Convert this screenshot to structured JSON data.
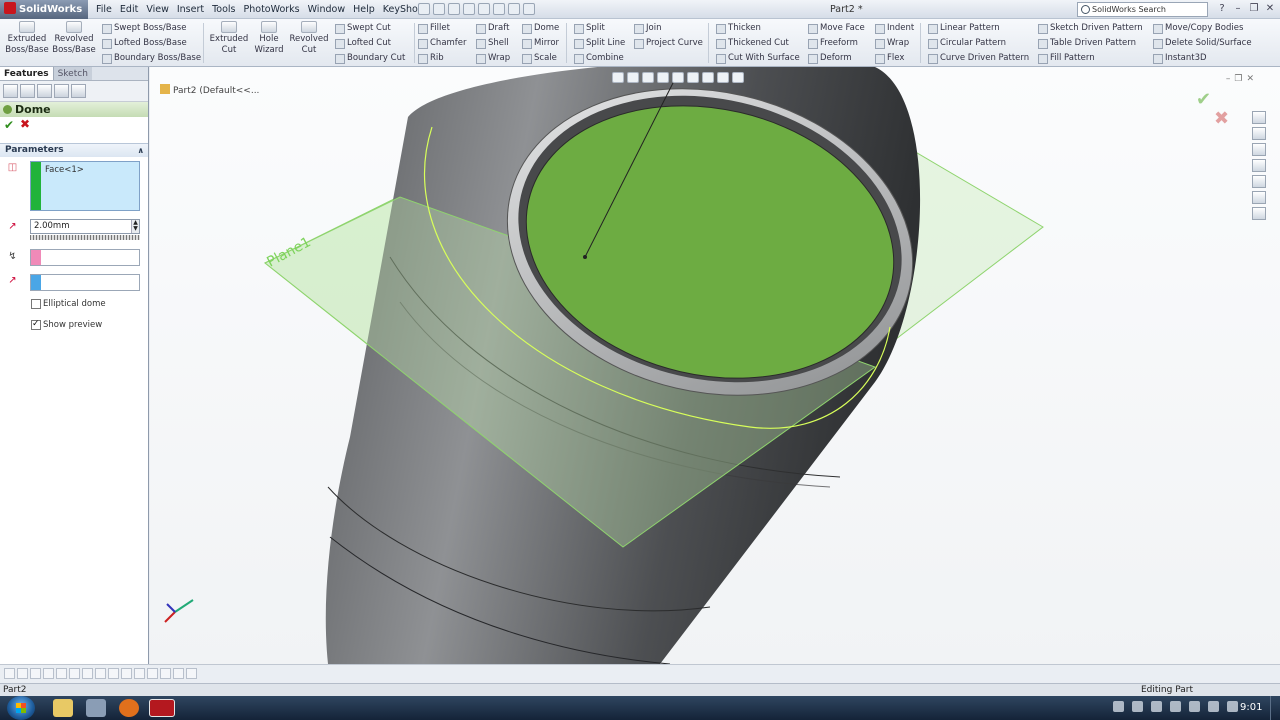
{
  "app": {
    "logo": "SolidWorks",
    "document_title": "Part2 *",
    "search_placeholder": "SolidWorks Search"
  },
  "menu": [
    "File",
    "Edit",
    "View",
    "Insert",
    "Tools",
    "PhotoWorks",
    "Window",
    "Help",
    "KeyShot"
  ],
  "cmd_big": [
    {
      "label": "Extruded Boss/Base",
      "icon": "extrude-boss-icon"
    },
    {
      "label": "Revolved Boss/Base",
      "icon": "revolve-boss-icon"
    },
    {
      "label": "Extruded Cut",
      "icon": "extrude-cut-icon"
    },
    {
      "label": "Hole Wizard",
      "icon": "hole-wizard-icon"
    },
    {
      "label": "Revolved Cut",
      "icon": "revolve-cut-icon"
    }
  ],
  "cmd_small": [
    [
      "Swept Boss/Base",
      "Lofted Boss/Base",
      "Boundary Boss/Base"
    ],
    [
      "Swept Cut",
      "Lofted Cut",
      "Boundary Cut"
    ],
    [
      "Fillet",
      "Chamfer",
      "Rib"
    ],
    [
      "Draft",
      "Shell",
      "Wrap"
    ],
    [
      "Dome",
      "Mirror",
      "Scale"
    ],
    [
      "Split",
      "Split Line",
      "Combine"
    ],
    [
      "Join",
      "Project Curve",
      ""
    ],
    [
      "Thicken",
      "Thickened Cut",
      "Cut With Surface"
    ],
    [
      "Move Face",
      "Freeform",
      "Deform"
    ],
    [
      "Indent",
      "Wrap",
      "Flex"
    ],
    [
      "Linear Pattern",
      "Circular Pattern",
      "Curve Driven Pattern"
    ],
    [
      "Sketch Driven Pattern",
      "Table Driven Pattern",
      "Fill Pattern"
    ],
    [
      "Move/Copy Bodies",
      "Delete Solid/Surface",
      "Instant3D"
    ]
  ],
  "panel": {
    "tabs": [
      "Features",
      "Sketch"
    ],
    "title": "Dome",
    "section": "Parameters",
    "selection": "Face<1>",
    "distance": "2.00mm",
    "elliptical_label": "Elliptical dome",
    "preview_label": "Show preview",
    "elliptical_checked": false,
    "preview_checked": true
  },
  "viewport": {
    "tree_label": "Part2  (Default<<...",
    "plane_label": "Plane1",
    "face_color": "#6dac42",
    "body_color": "#7d7f82",
    "plane_color": "#9be07f"
  },
  "status": {
    "left": "Part2",
    "mode": "Editing Part"
  },
  "taskbar": {
    "time": "9:01"
  }
}
